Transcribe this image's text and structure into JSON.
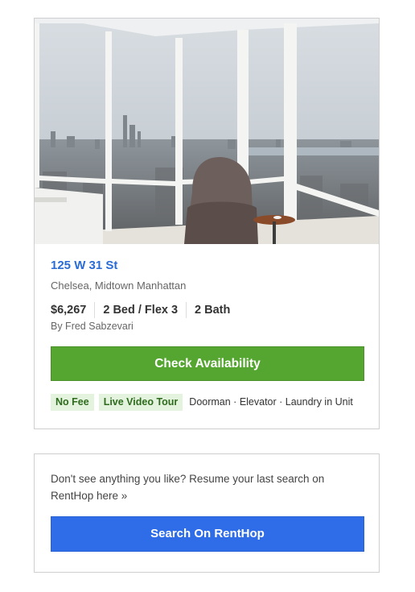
{
  "listing": {
    "image_alt": "Apartment photo: corner window view of Manhattan skyline with armchair",
    "address": "125 W 31 St",
    "neighborhood": "Chelsea, Midtown Manhattan",
    "price": "$6,267",
    "beds": "2 Bed / Flex 3",
    "baths": "2 Bath",
    "agent": "By Fred Sabzevari",
    "cta_label": "Check Availability",
    "tags": [
      "No Fee",
      "Live Video Tour"
    ],
    "amenities": "Doorman · Elevator · Laundry in Unit"
  },
  "resume": {
    "text": "Don't see anything you like? Resume your last search on RentHop here »",
    "button_label": "Search On RentHop"
  },
  "colors": {
    "link_blue": "#2a6bd5",
    "cta_green": "#55a630",
    "search_blue": "#2f6de8",
    "badge_bg": "#e3f3dd",
    "badge_text": "#2e6b1d"
  }
}
